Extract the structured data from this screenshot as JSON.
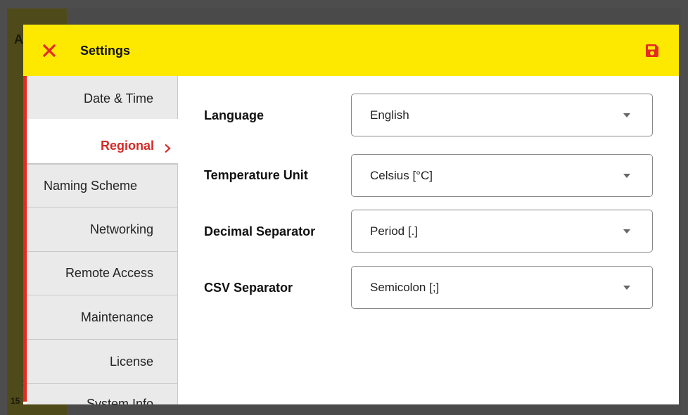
{
  "background": {
    "text_a": "A",
    "text_b": "15",
    "text_c": "1"
  },
  "dialog": {
    "title": "Settings",
    "close_icon": "close-icon",
    "save_icon": "save-icon",
    "accent_color": "#fde900",
    "highlight_color": "#e42a22"
  },
  "sidebar": {
    "items": [
      {
        "label": "Date & Time"
      },
      {
        "label": "Regional",
        "active": true
      },
      {
        "label": "Naming Scheme"
      },
      {
        "label": "Networking"
      },
      {
        "label": "Remote Access"
      },
      {
        "label": "Maintenance"
      },
      {
        "label": "License"
      },
      {
        "label": "System Info"
      }
    ]
  },
  "settings": {
    "language": {
      "label": "Language",
      "value": "English"
    },
    "temperature_unit": {
      "label": "Temperature Unit",
      "value": "Celsius [°C]"
    },
    "decimal_separator": {
      "label": "Decimal Separator",
      "value": "Period [.]"
    },
    "csv_separator": {
      "label": "CSV Separator",
      "value": "Semicolon [;]"
    }
  }
}
